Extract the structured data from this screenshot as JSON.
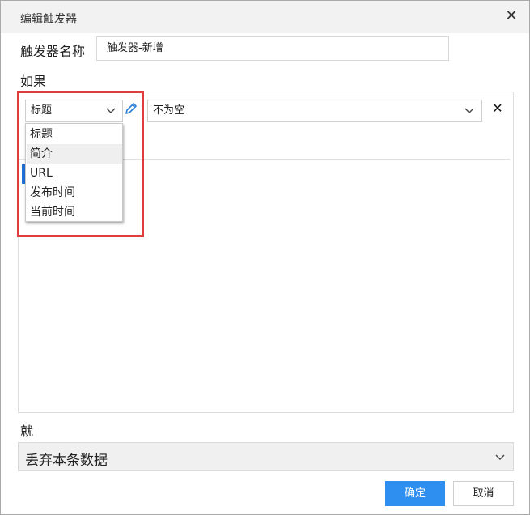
{
  "dialog": {
    "title": "编辑触发器",
    "close_icon": "close-icon"
  },
  "form": {
    "name_label": "触发器名称",
    "name_value": "触发器-新增",
    "if_label": "如果",
    "then_label": "就"
  },
  "condition": {
    "field_value": "标题",
    "operator_value": "不为空",
    "field_options": [
      "标题",
      "简介",
      "URL",
      "发布时间",
      "当前时间"
    ],
    "highlighted_option_index": 1,
    "edit_icon": "pencil-icon",
    "remove_icon": "close-icon"
  },
  "action": {
    "value": "丢弃本条数据"
  },
  "buttons": {
    "ok": "确定",
    "cancel": "取消"
  },
  "colors": {
    "primary": "#2f8ff0",
    "highlight_border": "#e13c3c",
    "accent_tab": "#1f6fd6"
  }
}
